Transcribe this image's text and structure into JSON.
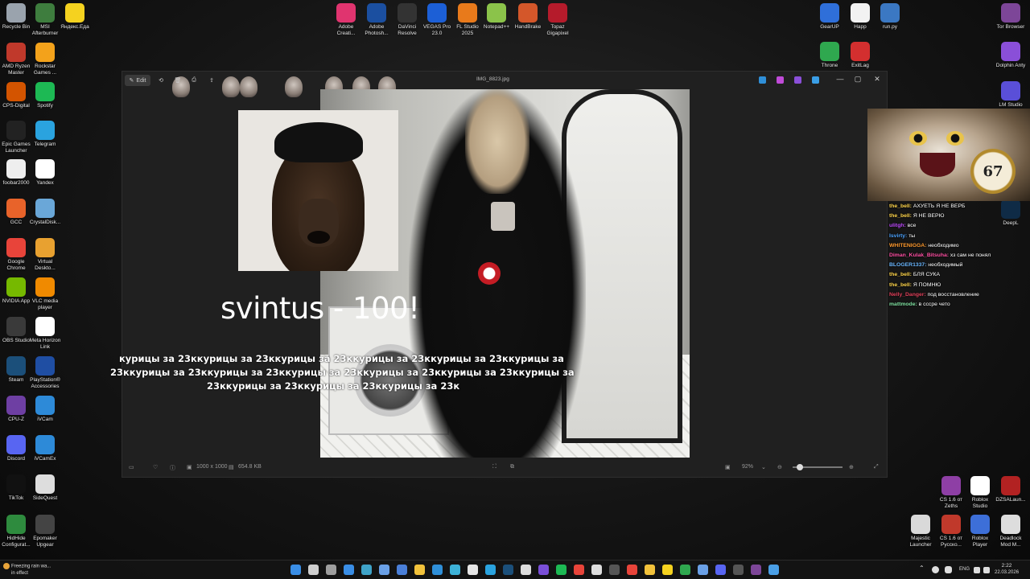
{
  "desktop_left": [
    {
      "label": "Recycle Bin",
      "color": "#9aa3ad",
      "icon": "recycle-bin-icon"
    },
    {
      "label": "MSI Afterburner",
      "color": "#3e7d3e",
      "icon": "afterburner-icon"
    },
    {
      "label": "Яндекс.Еда",
      "color": "#f5d21f",
      "icon": "yandex-eda-icon"
    },
    {
      "label": "AMD Ryzen Master",
      "color": "#c0392b",
      "icon": "ryzen-master-icon"
    },
    {
      "label": "Rockstar Games ...",
      "color": "#f3a21b",
      "icon": "rockstar-icon"
    },
    {
      "label": "CPS-Digital",
      "color": "#d35400",
      "icon": "cps-digital-icon"
    },
    {
      "label": "Spotify",
      "color": "#1db954",
      "icon": "spotify-icon"
    },
    {
      "label": "Epic Games Launcher",
      "color": "#222222",
      "icon": "epic-games-icon"
    },
    {
      "label": "Telegram",
      "color": "#2aa3df",
      "icon": "telegram-icon"
    },
    {
      "label": "foobar2000",
      "color": "#eeeeee",
      "icon": "foobar-icon"
    },
    {
      "label": "Yandex",
      "color": "#ffffff",
      "icon": "yandex-browser-icon"
    },
    {
      "label": "GCC",
      "color": "#e8632a",
      "icon": "gcc-icon"
    },
    {
      "label": "CrystalDisk...",
      "color": "#6aa7d8",
      "icon": "crystaldisk-icon"
    },
    {
      "label": "Google Chrome",
      "color": "#e8443a",
      "icon": "chrome-icon"
    },
    {
      "label": "Virtual Deskto...",
      "color": "#e8a130",
      "icon": "virtual-desktop-icon"
    },
    {
      "label": "NVIDIA App",
      "color": "#76b900",
      "icon": "nvidia-icon"
    },
    {
      "label": "VLC media player",
      "color": "#f08a00",
      "icon": "vlc-icon"
    },
    {
      "label": "OBS Studio",
      "color": "#3a3a3a",
      "icon": "obs-icon"
    },
    {
      "label": "Meta Horizon Link",
      "color": "#ffffff",
      "icon": "meta-icon"
    },
    {
      "label": "Steam",
      "color": "#1b4f7a",
      "icon": "steam-icon"
    },
    {
      "label": "PlayStation® Accessories",
      "color": "#1f4ea3",
      "icon": "playstation-icon"
    },
    {
      "label": "CPU-Z",
      "color": "#6e3fa3",
      "icon": "cpu-z-icon"
    },
    {
      "label": "iVCam",
      "color": "#2d8ad8",
      "icon": "ivcam-icon"
    },
    {
      "label": "Discord",
      "color": "#5865f2",
      "icon": "discord-icon"
    },
    {
      "label": "iVCamEx",
      "color": "#2d8ad8",
      "icon": "ivcamex-icon"
    },
    {
      "label": "TikTok",
      "color": "#111111",
      "icon": "tiktok-icon"
    },
    {
      "label": "SideQuest",
      "color": "#dddddd",
      "icon": "sidequest-icon"
    },
    {
      "label": "HidHide Configurat...",
      "color": "#2e8b3e",
      "icon": "hidhide-icon"
    },
    {
      "label": "Epomaker Upgear",
      "color": "#444444",
      "icon": "epomaker-icon"
    }
  ],
  "desktop_top": [
    {
      "label": "Adobe Creati...",
      "color": "#e0346f",
      "icon": "adobe-cc-icon"
    },
    {
      "label": "Adobe Photosh...",
      "color": "#1b4fa0",
      "icon": "photoshop-icon"
    },
    {
      "label": "DaVinci Resolve",
      "color": "#333333",
      "icon": "davinci-icon"
    },
    {
      "label": "VEGAS Pro 23.0",
      "color": "#1c5fd6",
      "icon": "vegas-icon"
    },
    {
      "label": "FL Studio 2025",
      "color": "#e87a1b",
      "icon": "fl-studio-icon"
    },
    {
      "label": "Notepad++",
      "color": "#8bc34a",
      "icon": "notepadpp-icon"
    },
    {
      "label": "HandBrake",
      "color": "#d4572a",
      "icon": "handbrake-icon"
    },
    {
      "label": "Topaz Gigapixel",
      "color": "#b51b2b",
      "icon": "topaz-icon"
    }
  ],
  "desktop_right": [
    {
      "label": "GearUP",
      "color": "#2f6fd9",
      "icon": "gearup-icon"
    },
    {
      "label": "Happ",
      "color": "#f2f2f2",
      "icon": "happ-icon"
    },
    {
      "label": "run.py",
      "color": "#3b78c3",
      "icon": "python-file-icon"
    },
    {
      "label": "Tor Browser",
      "color": "#7d4698",
      "icon": "tor-icon"
    },
    {
      "label": "Throne",
      "color": "#2fa84f",
      "icon": "throne-icon"
    },
    {
      "label": "ExitLag",
      "color": "#d32f2f",
      "icon": "exitlag-icon"
    },
    {
      "label": "Dolphin Anty",
      "color": "#8a4fd8",
      "icon": "dolphin-anty-icon"
    },
    {
      "label": "LM Studio",
      "color": "#5a4fd8",
      "icon": "lm-studio-icon"
    },
    {
      "label": "DeepL",
      "color": "#0f2b46",
      "icon": "deepl-icon"
    },
    {
      "label": "CS 1.6 от Zeths",
      "color": "#8e3fa5",
      "icon": "cs16-zeths-icon"
    },
    {
      "label": "Roblox Studio",
      "color": "#ffffff",
      "icon": "roblox-studio-icon"
    },
    {
      "label": "DZSALaun...",
      "color": "#b22222",
      "icon": "dzsa-icon"
    },
    {
      "label": "Majestic Launcher",
      "color": "#d9d9d9",
      "icon": "majestic-icon"
    },
    {
      "label": "CS 1.6 от Русско...",
      "color": "#c0392b",
      "icon": "cs16-ru-icon"
    },
    {
      "label": "Roblox Player",
      "color": "#3d6fd8",
      "icon": "roblox-player-icon"
    },
    {
      "label": "Deadlock Mod M...",
      "color": "#dddddd",
      "icon": "deadlock-icon"
    }
  ],
  "viewer": {
    "edit_label": "Edit",
    "file_name": "IMG_8823.jpg",
    "minimize": "—",
    "maximize": "▢",
    "close": "✕",
    "dimensions": "1000 x 1000",
    "file_size": "654.8 KB",
    "zoom": "92%"
  },
  "overlay": {
    "big_text": "svintus - 100!",
    "spam_lines": [
      "курицы за 23ккурицы за 23ккурицы за 23ккурицы за 23ккурицы за 23ккурицы за",
      "23ккурицы за 23ккурицы за 23ккурицы за 23ккурицы за 23ккурицы за 23ккурицы за",
      "23ккурицы за 23ккурицы за 23ккурицы за 23к"
    ]
  },
  "cat_overlay": {
    "clock_text": "67"
  },
  "chat": [
    {
      "user": "the_bell",
      "text": "АХУЕТЬ Я НЕ ВЕРБ",
      "color": "#ffd54a"
    },
    {
      "user": "the_bell",
      "text": "Я НЕ ВЕРЮ",
      "color": "#ffd54a"
    },
    {
      "user": "ulitgh",
      "text": "все",
      "color": "#c04bff"
    },
    {
      "user": "Isvirty",
      "text": "ты",
      "color": "#4ba3ff"
    },
    {
      "user": "WHITENIGGA",
      "text": "необходимо",
      "color": "#ff9a2e"
    },
    {
      "user": "Diman_Kulak_Bitsuha",
      "text": "хз сам не понял",
      "color": "#ff4fa3"
    },
    {
      "user": "BLOGER1337",
      "text": "необходимый",
      "color": "#6ab7ff"
    },
    {
      "user": "the_bell",
      "text": "БЛЯ СУКА",
      "color": "#ffd54a"
    },
    {
      "user": "the_bell",
      "text": "Я ПОМНЮ",
      "color": "#ffd54a"
    },
    {
      "user": "Nelly_Danger",
      "text": "под восстановление",
      "color": "#e0405a"
    },
    {
      "user": "mattmode",
      "text": "в сссре чето",
      "color": "#7fe0a0"
    }
  ],
  "taskbar": {
    "weather_line1": "Freezing rain wa...",
    "weather_line2": "in effect",
    "lang": "ENG",
    "time": "2:22",
    "date": "22.03.2026",
    "apps": [
      {
        "icon": "start-icon",
        "color": "#3a8ee6"
      },
      {
        "icon": "search-icon",
        "color": "#cfcfcf"
      },
      {
        "icon": "task-view-icon",
        "color": "#9e9e9e"
      },
      {
        "icon": "widgets-icon",
        "color": "#3a8ee6"
      },
      {
        "icon": "edge-icon",
        "color": "#3fa3c8"
      },
      {
        "icon": "copilot-icon",
        "color": "#6aa0e6"
      },
      {
        "icon": "store-icon",
        "color": "#4a7fd8"
      },
      {
        "icon": "explorer-icon",
        "color": "#f2c23b"
      },
      {
        "icon": "mail-icon",
        "color": "#2f8fd8"
      },
      {
        "icon": "photos-icon",
        "color": "#3db2d8"
      },
      {
        "icon": "calendar-icon",
        "color": "#e6e6e6"
      },
      {
        "icon": "telegram-task-icon",
        "color": "#2aa3df"
      },
      {
        "icon": "steam-task-icon",
        "color": "#1b4f7a"
      },
      {
        "icon": "chatgpt-icon",
        "color": "#dddddd"
      },
      {
        "icon": "obsidian-icon",
        "color": "#7a4fd8"
      },
      {
        "icon": "spotify-task-icon",
        "color": "#1db954"
      },
      {
        "icon": "chrome-task-icon",
        "color": "#e8443a"
      },
      {
        "icon": "epic-task-icon",
        "color": "#dddddd"
      },
      {
        "icon": "obs-task-icon",
        "color": "#555555"
      },
      {
        "icon": "yandex-task-icon",
        "color": "#e8443a"
      },
      {
        "icon": "lamp-icon",
        "color": "#f2c23b"
      },
      {
        "icon": "yandex-eda-task-icon",
        "color": "#f5d21f"
      },
      {
        "icon": "throne-task-icon",
        "color": "#2fa84f"
      },
      {
        "icon": "globe-icon",
        "color": "#6aa0e6"
      },
      {
        "icon": "discord-task-icon",
        "color": "#5865f2"
      },
      {
        "icon": "terminal-icon",
        "color": "#555555"
      },
      {
        "icon": "tor-task-icon",
        "color": "#7d4698"
      },
      {
        "icon": "tool-icon",
        "color": "#4a9fe6"
      }
    ]
  }
}
